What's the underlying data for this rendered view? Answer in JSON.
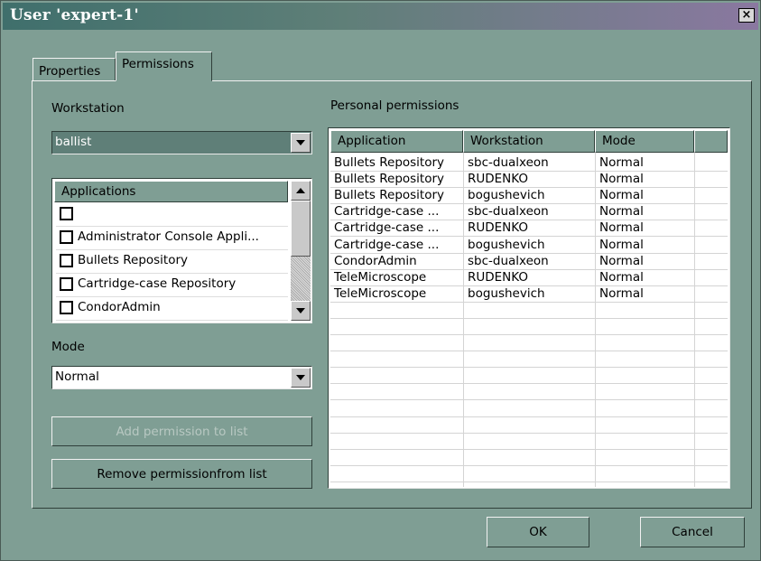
{
  "window": {
    "title": "User 'expert-1'",
    "close_label": "×"
  },
  "tabs": [
    {
      "label": "Properties"
    },
    {
      "label": "Permissions"
    }
  ],
  "workstation": {
    "label": "Workstation",
    "value": "ballist"
  },
  "applications": {
    "header": "Applications",
    "items": [
      {
        "label": ""
      },
      {
        "label": "Administrator Console Appli..."
      },
      {
        "label": "Bullets Repository"
      },
      {
        "label": "Cartridge-case Repository"
      },
      {
        "label": "CondorAdmin"
      }
    ]
  },
  "mode": {
    "label": "Mode",
    "value": "Normal"
  },
  "buttons": {
    "add": "Add permission to list",
    "remove": "Remove permissionfrom list",
    "ok": "OK",
    "cancel": "Cancel"
  },
  "permissions": {
    "label": "Personal permissions",
    "columns": [
      "Application",
      "Workstation",
      "Mode",
      ""
    ],
    "rows": [
      [
        "Bullets Repository",
        "sbc-dualxeon",
        "Normal"
      ],
      [
        "Bullets Repository",
        "RUDENKO",
        "Normal"
      ],
      [
        "Bullets Repository",
        "bogushevich",
        "Normal"
      ],
      [
        "Cartridge-case ...",
        "sbc-dualxeon",
        "Normal"
      ],
      [
        "Cartridge-case ...",
        "RUDENKO",
        "Normal"
      ],
      [
        "Cartridge-case ...",
        "bogushevich",
        "Normal"
      ],
      [
        "CondorAdmin",
        "sbc-dualxeon",
        "Normal"
      ],
      [
        "TeleMicroscope",
        "RUDENKO",
        "Normal"
      ],
      [
        "TeleMicroscope",
        "bogushevich",
        "Normal"
      ]
    ]
  }
}
